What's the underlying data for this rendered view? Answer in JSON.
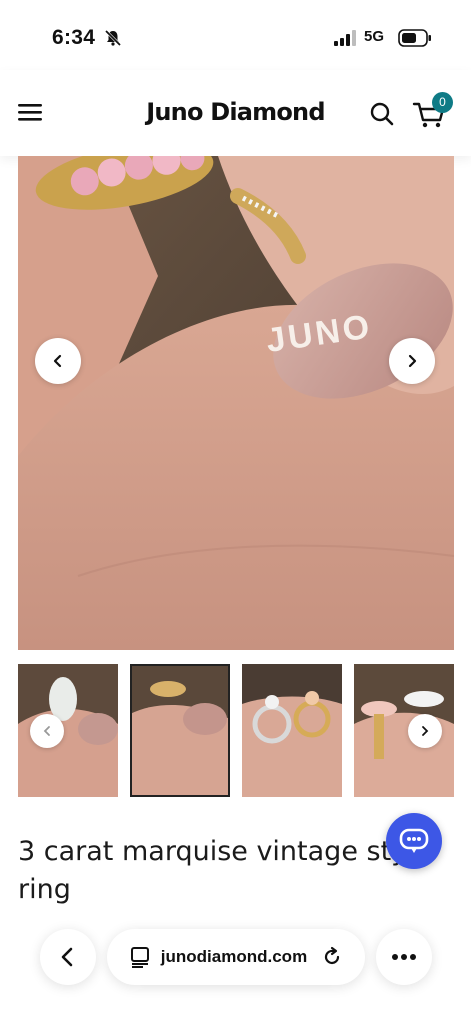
{
  "status_bar": {
    "time": "6:34",
    "network": "5G"
  },
  "header": {
    "brand": "Juno Diamond",
    "cart_count": "0"
  },
  "hero": {
    "alt": "Ring on hand"
  },
  "nail_text": "JUNO",
  "thumbnails": [
    "Gold ring view",
    "Ring on finger",
    "Two rings",
    "Rose and white rings"
  ],
  "product": {
    "title": "3 carat marquise vintage style ring"
  },
  "browser": {
    "url": "junodiamond.com"
  }
}
